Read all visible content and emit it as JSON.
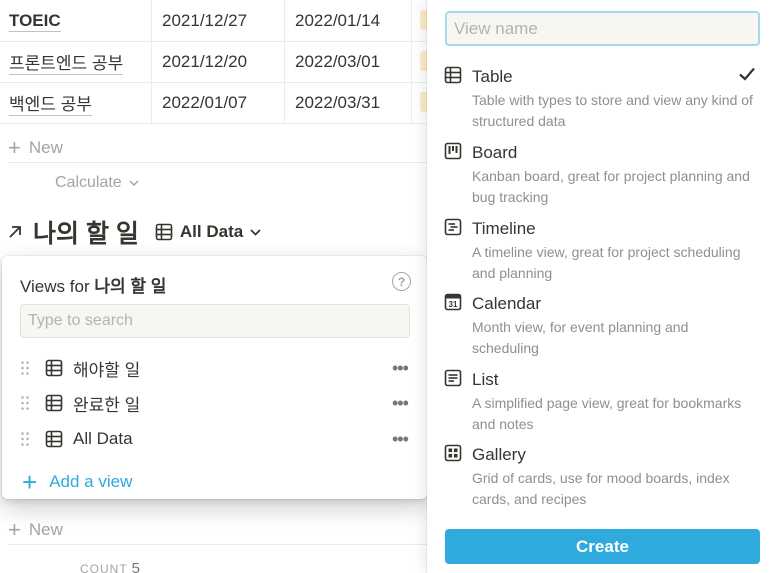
{
  "table": {
    "rows": [
      {
        "name": "TOEIC",
        "start": "2021/12/27",
        "end": "2022/01/14",
        "bold": true
      },
      {
        "name": "프론트엔드 공부",
        "start": "2021/12/20",
        "end": "2022/03/01",
        "bold": false
      },
      {
        "name": "백엔드 공부",
        "start": "2022/01/07",
        "end": "2022/03/31",
        "bold": false
      }
    ],
    "new_label": "New",
    "calculate_label": "Calculate"
  },
  "database": {
    "title": "나의 할 일",
    "current_view": "All Data",
    "new_label": "New",
    "count_label": "COUNT",
    "count_value": "5"
  },
  "views_popup": {
    "header_prefix": "Views for",
    "header_db": "나의 할 일",
    "search_placeholder": "Type to search",
    "views": [
      {
        "label": "해야할 일",
        "icon": "table-icon"
      },
      {
        "label": "완료한 일",
        "icon": "table-icon"
      },
      {
        "label": "All Data",
        "icon": "table-icon"
      }
    ],
    "add_label": "Add a view"
  },
  "new_view_panel": {
    "name_placeholder": "View name",
    "types": [
      {
        "name": "Table",
        "desc": "Table with types to store and view any kind of structured data",
        "icon": "table-icon",
        "selected": true
      },
      {
        "name": "Board",
        "desc": "Kanban board, great for project planning and bug tracking",
        "icon": "board-icon",
        "selected": false
      },
      {
        "name": "Timeline",
        "desc": "A timeline view, great for project scheduling and planning",
        "icon": "timeline-icon",
        "selected": false
      },
      {
        "name": "Calendar",
        "desc": "Month view, for event planning and scheduling",
        "icon": "calendar-icon",
        "icon_text": "31",
        "selected": false
      },
      {
        "name": "List",
        "desc": "A simplified page view, great for bookmarks and notes",
        "icon": "list-icon",
        "selected": false
      },
      {
        "name": "Gallery",
        "desc": "Grid of cards, use for mood boards, index cards, and recipes",
        "icon": "gallery-icon",
        "selected": false
      }
    ],
    "create_label": "Create"
  },
  "colors": {
    "accent": "#2eaadc",
    "focus_ring": "#a6d9ef",
    "text": "#37352f",
    "muted": "#a5a4a0"
  }
}
